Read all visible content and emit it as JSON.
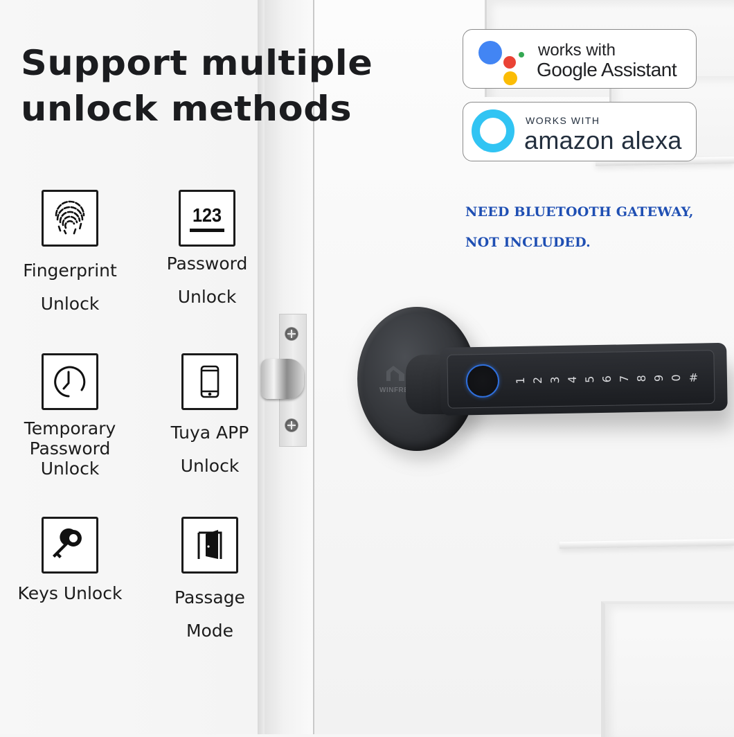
{
  "title": {
    "line1": "Support multiple",
    "line2": "unlock methods"
  },
  "features": [
    {
      "icon": "fingerprint-icon",
      "line1": "Fingerprint",
      "line2": "Unlock"
    },
    {
      "icon": "password-123-icon",
      "line1": "Password",
      "line2": "Unlock",
      "icon_text": "123"
    },
    {
      "icon": "clock-icon",
      "line1": "Temporary",
      "line2": "Password",
      "line3": "Unlock"
    },
    {
      "icon": "smartphone-icon",
      "line1": "Tuya APP",
      "line2": "Unlock"
    },
    {
      "icon": "key-icon",
      "line1": "Keys Unlock"
    },
    {
      "icon": "open-door-icon",
      "line1": "Passage",
      "line2": "Mode"
    }
  ],
  "badges": {
    "google": {
      "line1": "works with",
      "line2": "Google Assistant",
      "colors": [
        "#4285f4",
        "#ea4335",
        "#34a853",
        "#fbbc05"
      ]
    },
    "alexa": {
      "line1": "WORKS WITH",
      "line2": "amazon alexa",
      "color": "#31c4f3"
    }
  },
  "note": {
    "line1": "NEED BLUETOOTH GATEWAY,",
    "line2": "NOT INCLUDED.",
    "color": "#1f4fb3"
  },
  "lock": {
    "brand_watermark": "WINFREE",
    "keys": [
      "1",
      "2",
      "3",
      "4",
      "5",
      "6",
      "7",
      "8",
      "9",
      "0",
      "#"
    ]
  }
}
